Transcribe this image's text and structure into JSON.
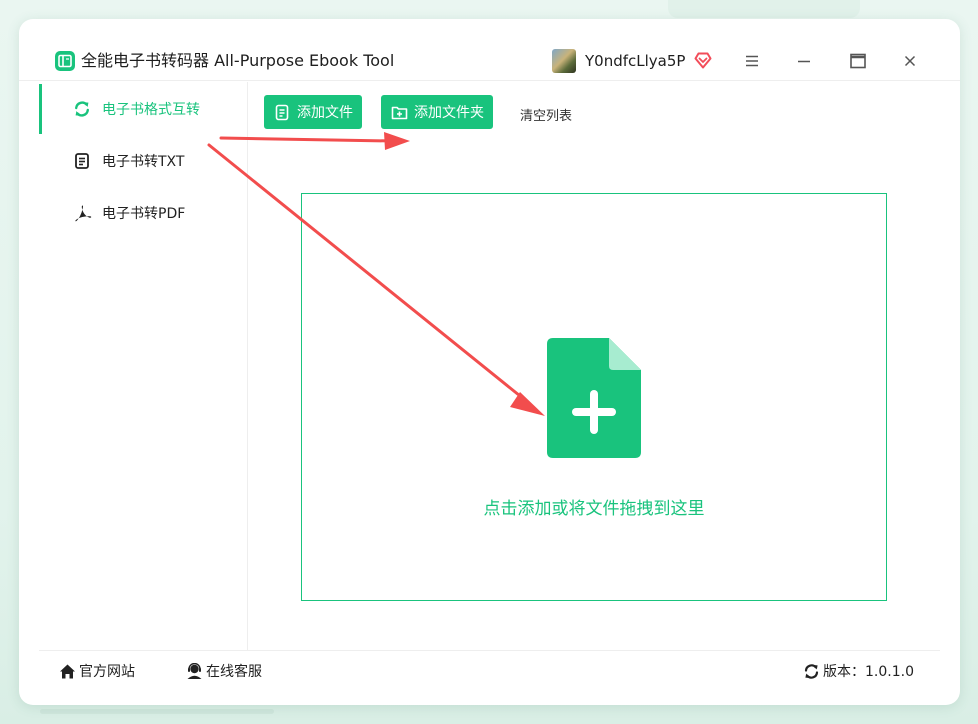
{
  "window": {
    "title": "全能电子书转码器 All-Purpose Ebook Tool",
    "user_name": "Y0ndfcLlya5P"
  },
  "sidebar": {
    "items": [
      {
        "label": "电子书格式互转",
        "icon": "refresh-icon",
        "active": true
      },
      {
        "label": "电子书转TXT",
        "icon": "document-icon",
        "active": false
      },
      {
        "label": "电子书转PDF",
        "icon": "pdf-icon",
        "active": false
      }
    ]
  },
  "toolbar": {
    "add_file_label": "添加文件",
    "add_folder_label": "添加文件夹",
    "clear_label": "清空列表"
  },
  "dropzone": {
    "hint": "点击添加或将文件拖拽到这里"
  },
  "footer": {
    "website_label": "官方网站",
    "support_label": "在线客服",
    "version_label": "版本：1.0.1.0"
  },
  "colors": {
    "accent": "#19c37d",
    "annotation_arrow": "#f24d4d",
    "vip": "#f24d5a"
  }
}
